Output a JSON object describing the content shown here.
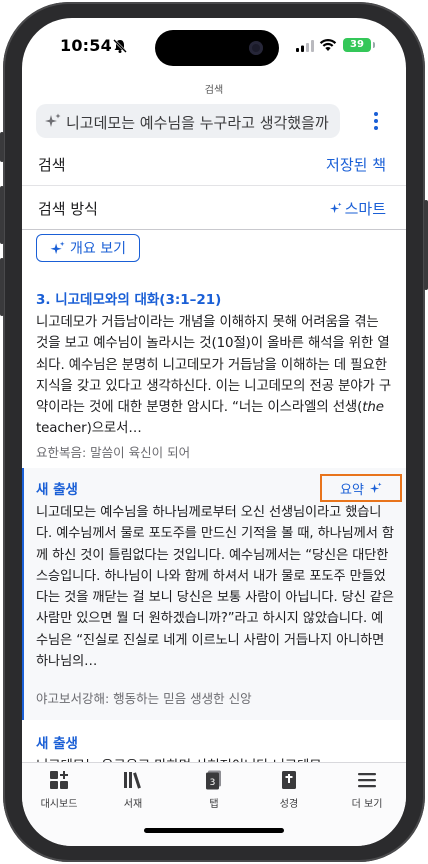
{
  "status_bar": {
    "time": "10:54",
    "battery": "39"
  },
  "header": {
    "title": "검색",
    "query": "니고데모는 예수님을 누구라고 생각했을까"
  },
  "rows": {
    "search": {
      "label": "검색",
      "value": "저장된 책"
    },
    "mode": {
      "label": "검색 방식",
      "value": "스마트"
    }
  },
  "overview_label": "개요 보기",
  "results": [
    {
      "title": "3. 니고데모와의 대화(3:1–21)",
      "body": "니고데모가 거듭남이라는 개념을 이해하지 못해 어려움을 겪는 것을 보고 예수님이 놀라시는 것(10절)이 올바른 해석을 위한 열쇠다. 예수님은 분명히 니고데모가 거듭남을 이해하는 데 필요한 지식을 갖고 있다고 생각하신다. 이는 니고데모의 전공 분야가 구약이라는 것에 대한 분명한 암시다. “너는 이스라엘의 선생(",
      "body_em": "the",
      "body_tail": " teacher)으로서…",
      "source": "요한복음: 말씀이 육신이 되어"
    },
    {
      "title": "새 출생",
      "body": "니고데모는 예수님을 하나님께로부터 오신 선생님이라고 했습니다. 예수님께서 물로 포도주를 만드신 기적을 볼 때, 하나님께서 함께 하신 것이 틀림없다는 것입니다. 예수님께서는 “당신은 대단한 스승입니다. 하나님이 나와 함께 하셔서 내가 물로 포도주 만들었다는 것을 깨닫는 걸 보니 당신은 보통 사람이 아닙니다. 당신 같은 사람만 있으면 뭘 더 원하겠습니까?”라고 하시지 않았습니다. 예수님은 “진실로 진실로 네게 이르노니 사람이 거듭나지 아니하면 하나님의…",
      "source": "야고보서강해: 행동하는 믿음 생생한 신앙",
      "summary_label": "요약"
    },
    {
      "title": "새 출생",
      "body": "니고데모는 유구유고 마하며 사혀저이니다 니고데모"
    }
  ],
  "tabs": [
    {
      "label": "대시보드",
      "icon": "dashboard-icon"
    },
    {
      "label": "서재",
      "icon": "library-icon"
    },
    {
      "label": "탭",
      "icon": "tabs-icon",
      "badge": "3"
    },
    {
      "label": "성경",
      "icon": "bible-icon"
    },
    {
      "label": "더 보기",
      "icon": "more-icon"
    }
  ],
  "colors": {
    "accent": "#1a5fd6",
    "highlight": "#e8741c",
    "battery": "#34c759"
  }
}
